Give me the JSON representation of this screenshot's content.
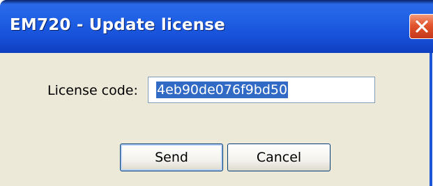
{
  "window": {
    "title": "EM720 - Update license"
  },
  "form": {
    "license_label": "License code:",
    "license_value": "4eb90de076f9bd50"
  },
  "buttons": {
    "send_label": "Send",
    "cancel_label": "Cancel"
  },
  "icons": {
    "close": "close-icon"
  }
}
